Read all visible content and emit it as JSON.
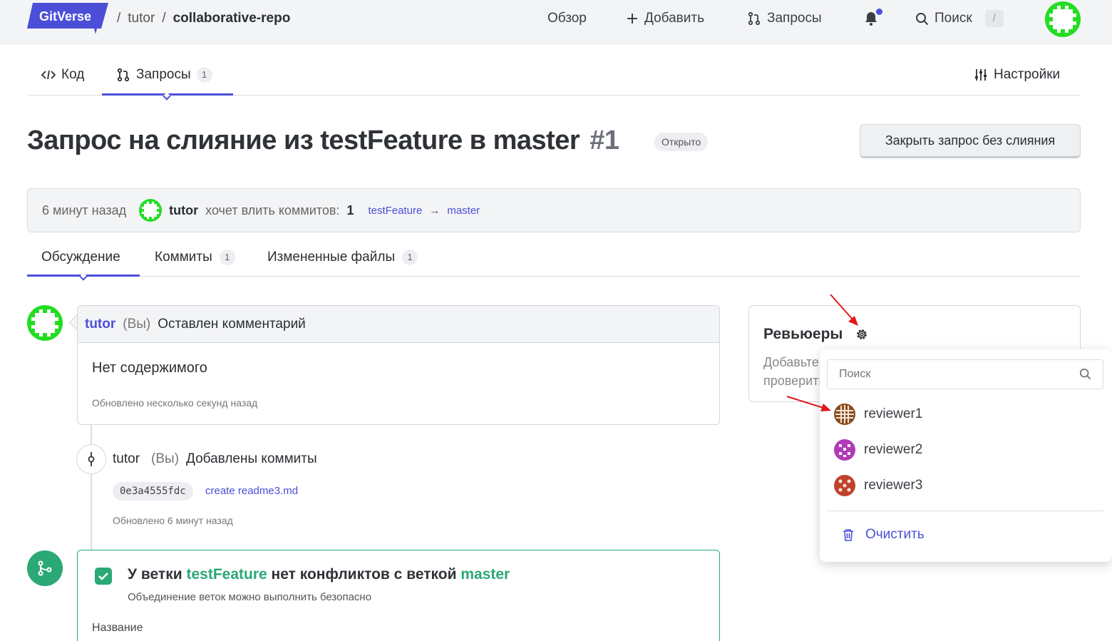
{
  "header": {
    "logo_text": "GitVerse",
    "breadcrumb_sep": "/",
    "owner": "tutor",
    "repo": "collaborative-repo",
    "nav": {
      "overview": "Обзор",
      "add": "Добавить",
      "requests": "Запросы",
      "search": "Поиск",
      "search_kbd": "/"
    }
  },
  "repo_tabs": {
    "code": "Код",
    "requests": "Запросы",
    "requests_count": "1",
    "settings": "Настройки"
  },
  "pr": {
    "title": "Запрос на слияние из testFeature в master",
    "number": "#1",
    "status": "Открыто",
    "close_button": "Закрыть запрос без слияния",
    "info": {
      "time": "6 минут назад",
      "user": "tutor",
      "action": "хочет влить коммитов:",
      "count": "1",
      "source_branch": "testFeature",
      "arrow": "→",
      "target_branch": "master"
    }
  },
  "pr_tabs": {
    "discussion": "Обсуждение",
    "commits": "Коммиты",
    "commits_count": "1",
    "files": "Измененные файлы",
    "files_count": "1"
  },
  "timeline": {
    "comment": {
      "author": "tutor",
      "you": "(Вы)",
      "action": "Оставлен комментарий",
      "body": "Нет содержимого",
      "updated": "Обновлено несколько секунд назад"
    },
    "commits_event": {
      "author": "tutor",
      "you": "(Вы)",
      "action": "Добавлены коммиты",
      "sha": "0e3a4555fdc",
      "message": "create readme3.md",
      "updated": "Обновлено 6 минут назад"
    },
    "merge": {
      "prefix": "У ветки",
      "source": "testFeature",
      "middle": "нет конфликтов с веткой",
      "target": "master",
      "subtitle": "Объединение веток можно выполнить безопасно",
      "name_label": "Название"
    }
  },
  "reviewers": {
    "title": "Ревьюеры",
    "desc_line1": "Добавьте",
    "desc_line2": "проверить",
    "dropdown": {
      "search_placeholder": "Поиск",
      "items": [
        {
          "name": "reviewer1",
          "color": "#8a4b1e"
        },
        {
          "name": "reviewer2",
          "color": "#b03ab8"
        },
        {
          "name": "reviewer3",
          "color": "#c0422c"
        }
      ],
      "clear": "Очистить"
    }
  },
  "colors": {
    "accent": "#4b4fd8",
    "success": "#2aa876",
    "annotation": "#e0191c",
    "avatar_green": "#22dd22"
  }
}
